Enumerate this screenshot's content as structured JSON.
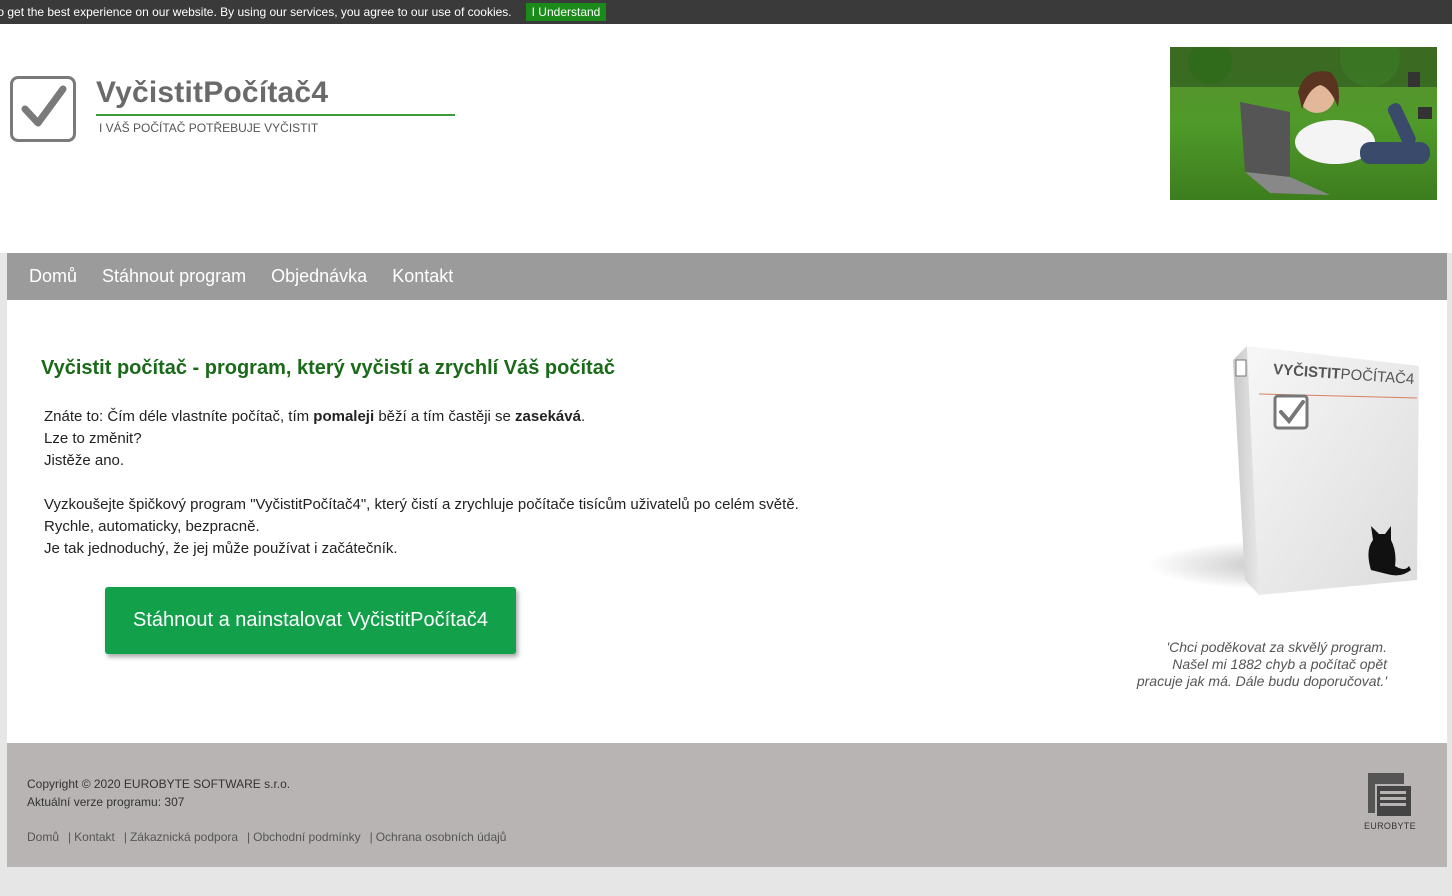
{
  "cookie_bar": {
    "text": "to get the best experience on our website. By using our services, you agree to our use of cookies.",
    "button_label": "I Understand"
  },
  "header": {
    "title": "VyčistitPočítač4",
    "tagline": "I VÁŠ POČÍTAČ POTŘEBUJE VYČISTIT"
  },
  "nav": {
    "items": [
      {
        "label": "Domů"
      },
      {
        "label": "Stáhnout program"
      },
      {
        "label": "Objednávka"
      },
      {
        "label": "Kontakt"
      }
    ]
  },
  "main": {
    "headline": "Vyčistit počítač - program, který vyčistí a zrychlí Váš počítač",
    "intro": {
      "line1_start": "Znáte to: Čím déle vlastníte počítač, tím ",
      "line1_bold1": "pomaleji",
      "line1_mid": " běží a tím častěji se ",
      "line1_bold2": "zasekává",
      "line1_end": ".",
      "line2": "Lze to změnit?",
      "line3": "Jistěže ano."
    },
    "pitch": {
      "line1": "Vyzkoušejte špičkový program \"VyčistitPočítač4\", který čistí a zrychluje počítače tisícům uživatelů po celém světě.",
      "line2": "Rychle, automaticky, bezpracně.",
      "line3": "Je tak jednoduchý, že jej může používat i začátečník."
    },
    "cta_label": "Stáhnout a nainstalovat VyčistitPočítač4",
    "box_label_bold": "VYČISTIT",
    "box_label_rest": "POČÍTAČ4",
    "testimonial": {
      "line1": "'Chci poděkovat za skvělý program.",
      "line2": "Našel mi 1882 chyb a počítač opět",
      "line3": "pracuje jak má. Dále budu doporučovat.'"
    }
  },
  "footer": {
    "copyright": "Copyright © 2020 EUROBYTE SOFTWARE s.r.o.",
    "version": "Aktuální verze programu: 307",
    "links": [
      {
        "label": "Domů"
      },
      {
        "label": "Kontakt"
      },
      {
        "label": "Zákaznická podpora"
      },
      {
        "label": "Obchodní podmínky"
      },
      {
        "label": "Ochrana osobních údajů"
      }
    ],
    "separator": "|",
    "brand": "EUROBYTE"
  },
  "colors": {
    "nav_bg": "#9b9b9b",
    "cta_bg": "#12a04a",
    "headline": "#1a6a1a",
    "footer_bg": "#b9b4b4"
  }
}
